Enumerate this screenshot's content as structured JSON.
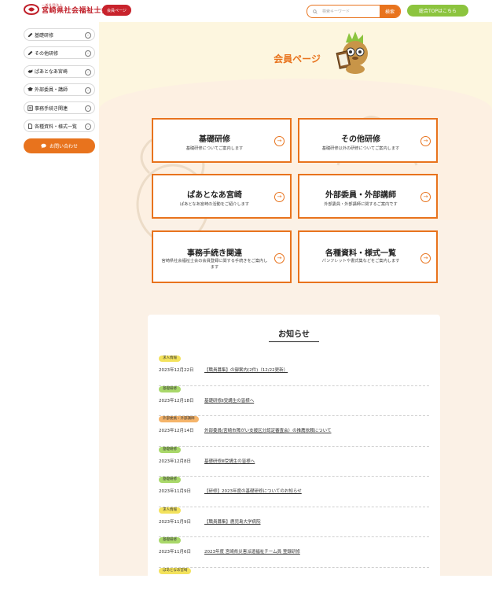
{
  "header": {
    "logo_sub": "一般社団法人",
    "logo_main": "宮崎県社会福祉士会",
    "member_pill": "会員ページ",
    "search_placeholder": "検索キーワード",
    "search_button": "検索",
    "top_button": "総合TOPはこちら"
  },
  "sidebar": {
    "items": [
      {
        "label": "基礎研修",
        "icon": "pencil-icon"
      },
      {
        "label": "その他研修",
        "icon": "pencil-icon"
      },
      {
        "label": "ぱあとなあ宮崎",
        "icon": "handshake-icon"
      },
      {
        "label": "外部委員・講師",
        "icon": "graduation-cap-icon"
      },
      {
        "label": "事務手続き関連",
        "icon": "document-icon"
      },
      {
        "label": "各種資料・様式一覧",
        "icon": "file-icon"
      }
    ],
    "contact": "お問い合わせ"
  },
  "main": {
    "title": "会員ページ",
    "cards": [
      {
        "title": "基礎研修",
        "desc": "基礎研修についてご案内します"
      },
      {
        "title": "その他研修",
        "desc": "基礎研修以外の研修についてご案内します"
      },
      {
        "title": "ぱあとなあ宮崎",
        "desc": "ぱあとなあ宮崎の活動をご紹介します"
      },
      {
        "title": "外部委員・外部講師",
        "desc": "外部委員・外部講師に関するご案内です"
      },
      {
        "title": "事務手続き関連",
        "desc": "宮崎県社会福祉士会の会員登録に関する手続きをご案内します"
      },
      {
        "title": "各種資料・様式一覧",
        "desc": "パンフレットや書式集などをご案内します"
      }
    ]
  },
  "news": {
    "title": "お知らせ",
    "items": [
      {
        "tag": "求人情報",
        "date": "2023年12月22日",
        "text": "【職員募集】の御案内(2件)（12/22更新）"
      },
      {
        "tag": "基礎研修",
        "date": "2023年12月18日",
        "text": "基礎研修Ⅱ受講生の皆様へ"
      },
      {
        "tag": "外部委員・外部講師",
        "date": "2023年12月14日",
        "text": "外部委員(宮崎市障がい支援区分認定審査会）の推薦依頼について"
      },
      {
        "tag": "基礎研修",
        "date": "2023年12月8日",
        "text": "基礎研修Ⅲ受講生の皆様へ"
      },
      {
        "tag": "基礎研修",
        "date": "2023年11月9日",
        "text": "【研修】2023年度の基礎研修についてのお知らせ"
      },
      {
        "tag": "求人情報",
        "date": "2023年11月9日",
        "text": "【職員募集】鹿児島大学病院"
      },
      {
        "tag": "基礎研修",
        "date": "2023年11月6日",
        "text": "2023年度 宮崎県災害派遣福祉チーム員 登録研修"
      },
      {
        "tag": "ぱあとなあ宮崎",
        "date": "",
        "text": ""
      }
    ]
  },
  "colors": {
    "accent": "#e8731d",
    "brand_red": "#c8232c",
    "green": "#8cc43e",
    "hero_bg": "#fdf6df"
  }
}
